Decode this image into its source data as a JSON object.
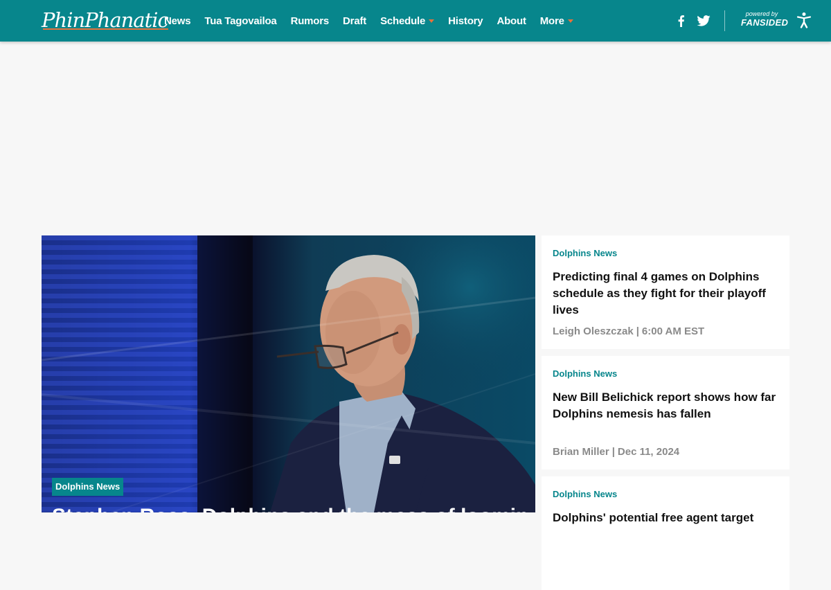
{
  "header": {
    "logo": "PhinPhanatic",
    "nav": [
      {
        "label": "News",
        "dropdown": false
      },
      {
        "label": "Tua Tagovailoa",
        "dropdown": false
      },
      {
        "label": "Rumors",
        "dropdown": false
      },
      {
        "label": "Draft",
        "dropdown": false
      },
      {
        "label": "Schedule",
        "dropdown": true
      },
      {
        "label": "History",
        "dropdown": false
      },
      {
        "label": "About",
        "dropdown": false
      },
      {
        "label": "More",
        "dropdown": true
      }
    ],
    "powered_by": "powered by",
    "network": "FANSIDED",
    "icons": [
      "facebook-icon",
      "twitter-icon",
      "accessibility-icon"
    ]
  },
  "hero": {
    "category": "Dolphins News",
    "title": "Stephen Ross, Dolphins and the mess of looming finances"
  },
  "cards": [
    {
      "category": "Dolphins News",
      "title": "Predicting final 4 games on Dolphins schedule as they fight for their playoff lives",
      "author": "Leigh Oleszczak",
      "time": "6:00 AM EST"
    },
    {
      "category": "Dolphins News",
      "title": "New Bill Belichick report shows how far Dolphins nemesis has fallen",
      "author": "Brian Miller",
      "time": "Dec 11, 2024"
    },
    {
      "category": "Dolphins News",
      "title": "Dolphins' potential free agent target",
      "author": "",
      "time": ""
    }
  ],
  "colors": {
    "brand": "#07868c",
    "accent": "#e8713a",
    "background": "#f7f7f7"
  }
}
